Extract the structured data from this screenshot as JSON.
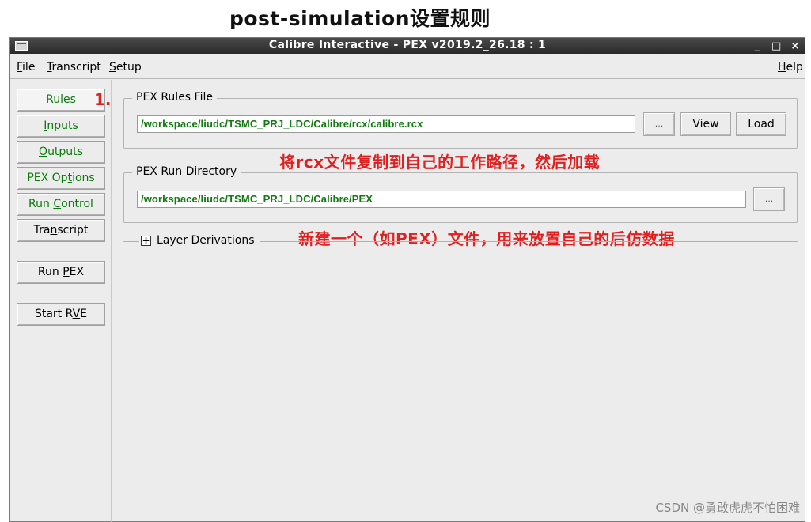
{
  "page_heading": "post-simulation设置规则",
  "window": {
    "title": "Calibre Interactive - PEX v2019.2_26.18 : 1",
    "controls": {
      "minimize": "_",
      "maximize": "□",
      "close": "×"
    }
  },
  "menu": {
    "file": {
      "key": "F",
      "rest": "ile"
    },
    "transcript": {
      "key": "T",
      "rest": "ranscript"
    },
    "setup": {
      "key": "S",
      "rest": "etup"
    },
    "help": {
      "pre": "",
      "key": "H",
      "rest": "elp"
    }
  },
  "sidebar": {
    "rules": {
      "key": "R",
      "rest": "ules"
    },
    "inputs": {
      "key": "I",
      "rest": "nputs"
    },
    "outputs": {
      "key": "O",
      "rest": "utputs"
    },
    "pex_options": {
      "pre": "PEX Op",
      "key": "t",
      "rest": "ions"
    },
    "run_control": {
      "pre": "Run ",
      "key": "C",
      "rest": "ontrol"
    },
    "transcript": {
      "pre": "Tra",
      "key": "n",
      "rest": "script"
    },
    "run_pex": {
      "pre": "Run ",
      "key": "P",
      "rest": "EX"
    },
    "start_rve": {
      "pre": "Start R",
      "key": "V",
      "rest": "E"
    }
  },
  "annotations": {
    "step_marker": "1.",
    "rules_note": "将rcx文件复制到自己的工作路径，然后加载",
    "rundir_note": "新建一个（如PEX）文件，用来放置自己的后仿数据"
  },
  "rules_file": {
    "label": "PEX Rules File",
    "path": "/workspace/liudc/TSMC_PRJ_LDC/Calibre/rcx/calibre.rcx",
    "browse_label": "...",
    "view_label": "View",
    "load_label": "Load"
  },
  "run_directory": {
    "label": "PEX Run Directory",
    "path": "/workspace/liudc/TSMC_PRJ_LDC/Calibre/PEX",
    "browse_label": "..."
  },
  "layer_derivations": {
    "expander": "+",
    "label": "Layer Derivations"
  },
  "watermark": "CSDN @勇敢虎虎不怕困难",
  "colors": {
    "path_text": "#117a11",
    "annotation": "#e02020",
    "titlebar": "#333333"
  }
}
